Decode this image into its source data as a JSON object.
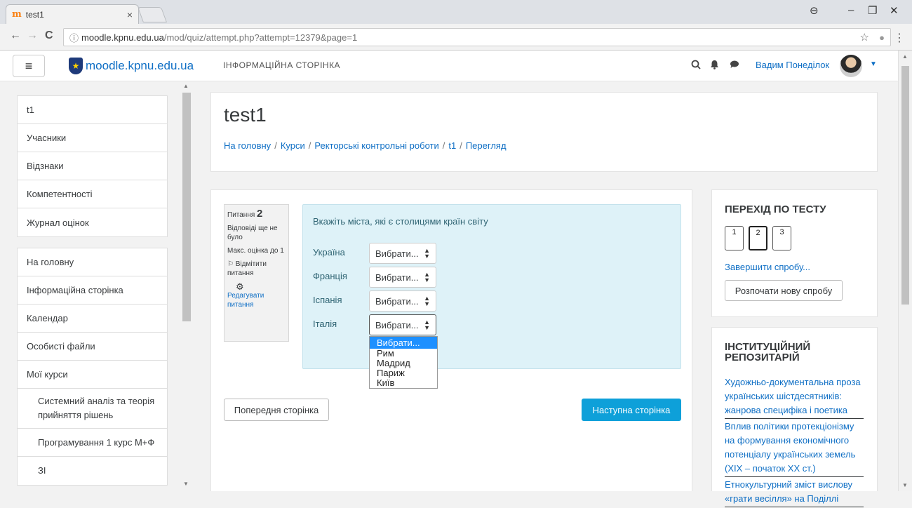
{
  "browser": {
    "tab_title": "test1",
    "tab_favicon": "m",
    "tab_close": "×",
    "win_account": "⊖",
    "win_minimize": "–",
    "win_restore": "❐",
    "win_close": "✕",
    "nav_back": "←",
    "nav_forward": "→",
    "nav_reload": "C",
    "url_info": "ⓘ",
    "url_host": "moodle.kpnu.edu.ua",
    "url_path": "/mod/quiz/attempt.php?attempt=12379&page=1",
    "star": "☆",
    "menu": "⋮"
  },
  "header": {
    "menu_icon": "≡",
    "logo_glyph": "★",
    "site_name": "moodle.kpnu.edu.ua",
    "site_page_link": "ІНФОРМАЦІЙНА СТОРІНКА",
    "search_icon": "🔍",
    "bell_icon": "🔔",
    "chat_icon": "💬",
    "user_name": "Вадим Понеділок",
    "user_caret": "▼"
  },
  "sidebar": {
    "course_items": [
      {
        "label": "t1"
      },
      {
        "label": "Учасники"
      },
      {
        "label": "Відзнаки"
      },
      {
        "label": "Компетентності"
      },
      {
        "label": "Журнал оцінок"
      }
    ],
    "site_items": [
      {
        "label": "На головну"
      },
      {
        "label": "Інформаційна сторінка"
      },
      {
        "label": "Календар"
      },
      {
        "label": "Особисті файли"
      },
      {
        "label": "Мої курси"
      }
    ],
    "course_links": [
      {
        "label": "Системний аналіз та теорія прийняття рішень"
      },
      {
        "label": "Програмування 1 курс М+Ф"
      },
      {
        "label": "ЗІ"
      }
    ]
  },
  "page": {
    "title": "test1",
    "breadcrumb": [
      "На головну",
      "Курси",
      "Ректорські контрольні роботи",
      "t1",
      "Перегляд"
    ],
    "breadcrumb_sep": "/"
  },
  "question": {
    "number_label": "Питання",
    "number": "2",
    "status": "Відповіді ще не було",
    "max_mark": "Макс. оцінка до 1",
    "flag_label": "Відмітити питання",
    "flag_icon": "⚐",
    "gear_icon": "⚙",
    "edit_label": "Редагувати питання",
    "text": "Вкажіть міста, які є столицями країн світу",
    "rows": [
      {
        "label": "Україна",
        "value": "Вибрати..."
      },
      {
        "label": "Франція",
        "value": "Вибрати..."
      },
      {
        "label": "Іспанія",
        "value": "Вибрати..."
      },
      {
        "label": "Італія",
        "value": "Вибрати..."
      }
    ],
    "select_arrows": "▲\n▼",
    "options": [
      "Вибрати...",
      "Рим",
      "Мадрид",
      "Париж",
      "Київ"
    ]
  },
  "nav_buttons": {
    "prev": "Попередня сторінка",
    "next": "Наступна сторінка"
  },
  "quiz_nav": {
    "title": "ПЕРЕХІД ПО ТЕСТУ",
    "buttons": [
      "1",
      "2",
      "3"
    ],
    "finish_link": "Завершити спробу...",
    "restart_button": "Розпочати нову спробу"
  },
  "repo": {
    "title": "ІНСТИТУЦІЙНИЙ РЕПОЗИТАРІЙ",
    "items": [
      "Художньо-документальна проза українських шістдесятників: жанрова специфіка і поетика",
      "Вплив політики протекціонізму на формування економічного потенціалу українських земель (ХІХ – початок ХХ ст.)",
      "Етнокультурний зміст вислову «грати весілля» на Поділлі"
    ]
  }
}
